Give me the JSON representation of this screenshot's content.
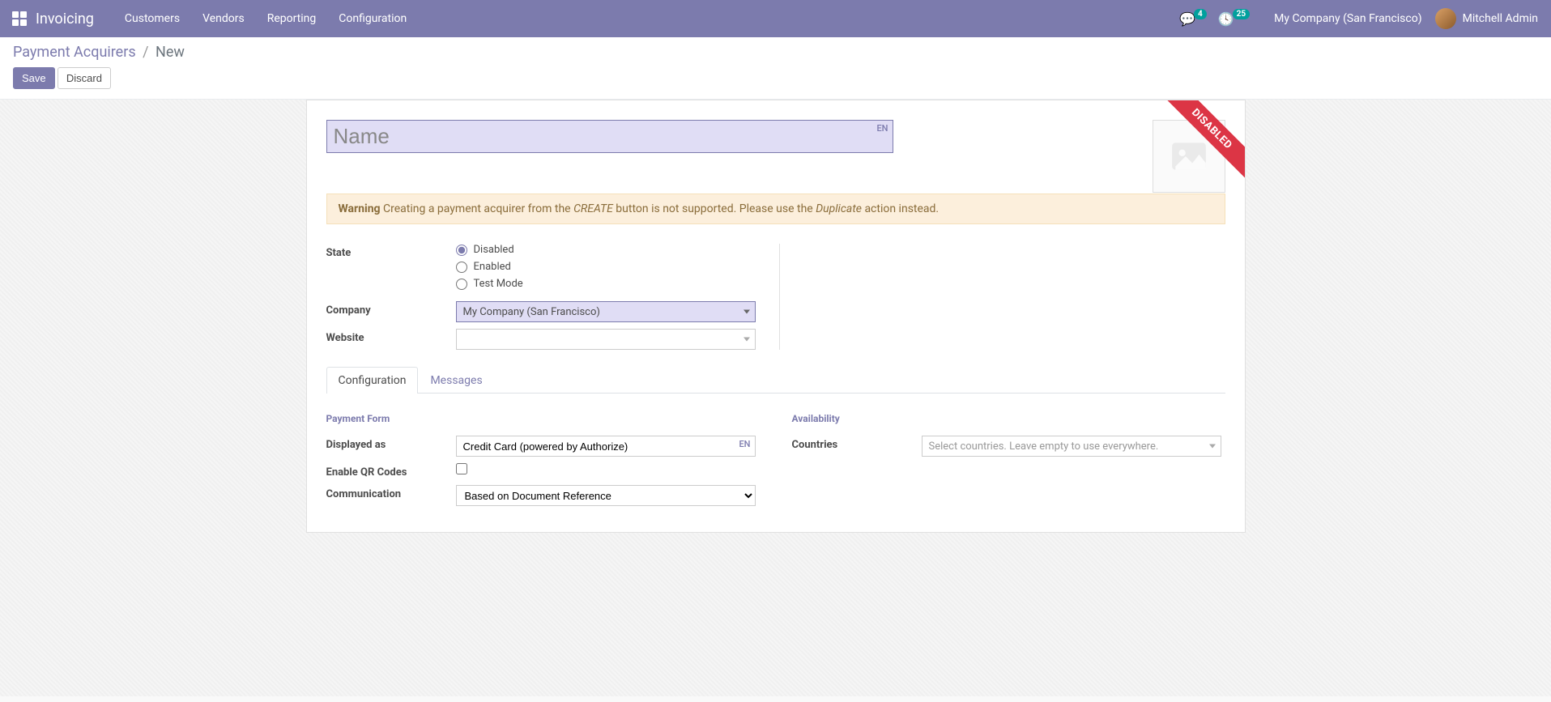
{
  "navbar": {
    "brand": "Invoicing",
    "items": [
      "Customers",
      "Vendors",
      "Reporting",
      "Configuration"
    ],
    "messages_count": "4",
    "activities_count": "25",
    "company": "My Company (San Francisco)",
    "username": "Mitchell Admin"
  },
  "breadcrumb": {
    "parent": "Payment Acquirers",
    "current": "New"
  },
  "buttons": {
    "save": "Save",
    "discard": "Discard"
  },
  "ribbon": "DISABLED",
  "name_field": {
    "value": "",
    "placeholder": "Name",
    "lang": "EN"
  },
  "warning": {
    "label": "Warning",
    "pre": " Creating a payment acquirer from the ",
    "em1": "CREATE",
    "mid": " button is not supported. Please use the ",
    "em2": "Duplicate",
    "post": " action instead."
  },
  "fields": {
    "state_label": "State",
    "state_options": {
      "disabled": "Disabled",
      "enabled": "Enabled",
      "test": "Test Mode"
    },
    "company_label": "Company",
    "company_value": "My Company (San Francisco)",
    "website_label": "Website",
    "website_value": ""
  },
  "tabs": {
    "configuration": "Configuration",
    "messages": "Messages"
  },
  "config": {
    "payment_form_title": "Payment Form",
    "displayed_as_label": "Displayed as",
    "displayed_as_value": "Credit Card (powered by Authorize)",
    "displayed_as_lang": "EN",
    "enable_qr_label": "Enable QR Codes",
    "communication_label": "Communication",
    "communication_value": "Based on Document Reference",
    "availability_title": "Availability",
    "countries_label": "Countries",
    "countries_placeholder": "Select countries. Leave empty to use everywhere."
  }
}
